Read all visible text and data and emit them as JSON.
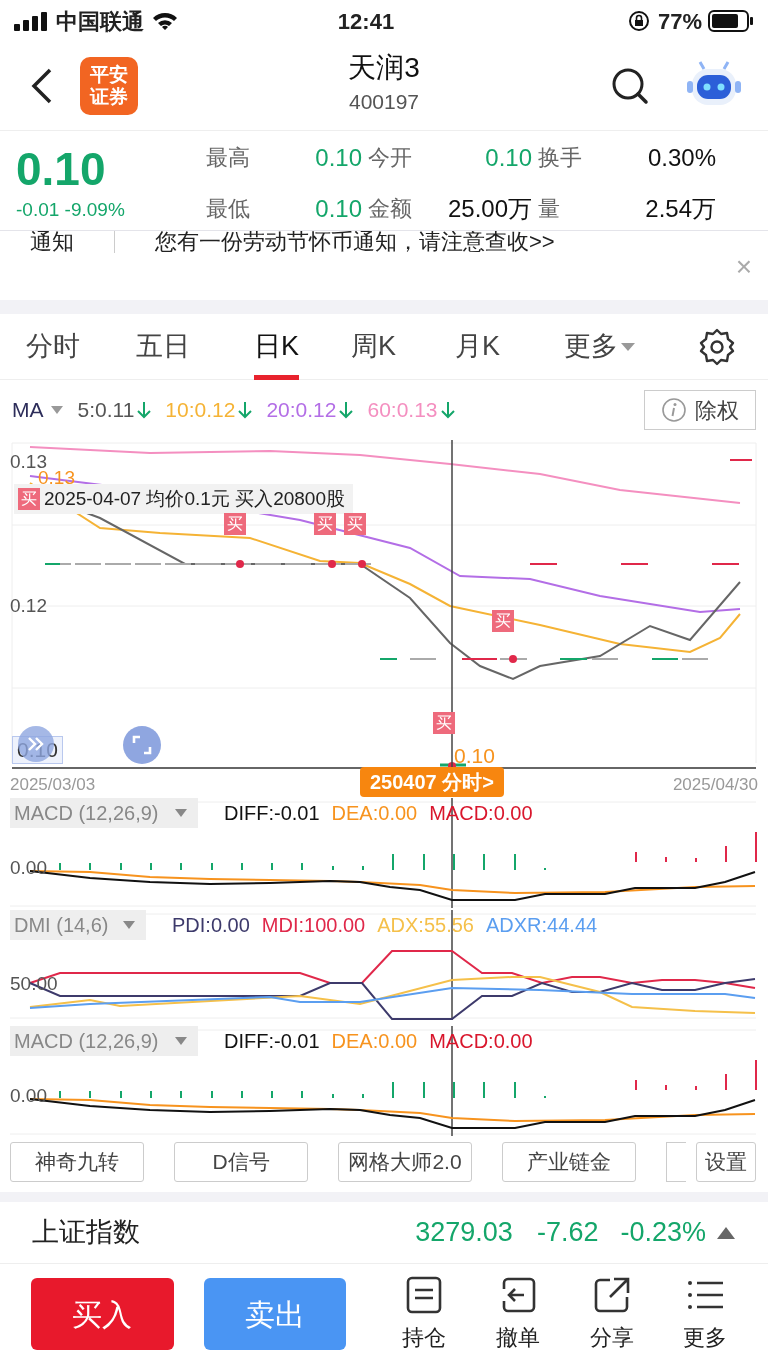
{
  "status_bar": {
    "carrier": "中国联通",
    "time": "12:41",
    "battery": "77%"
  },
  "header": {
    "title": "天润3",
    "code": "400197",
    "logo": [
      "平安",
      "证券"
    ]
  },
  "quote": {
    "price": "0.10",
    "change": "-0.01 -9.09%",
    "stats": [
      {
        "label": "最高",
        "value": "0.10",
        "kind": "down"
      },
      {
        "label": "今开",
        "value": "0.10",
        "kind": "down"
      },
      {
        "label": "换手",
        "value": "0.30%",
        "kind": "plain"
      },
      {
        "label": "最低",
        "value": "0.10",
        "kind": "down"
      },
      {
        "label": "金额",
        "value": "25.00万",
        "kind": "plain"
      },
      {
        "label": "量",
        "value": "2.54万",
        "kind": "plain"
      }
    ]
  },
  "notice": {
    "tag": "通知",
    "text": "您有一份劳动节怀币通知，请注意查收>>",
    "close": "×"
  },
  "tabs": [
    {
      "label": "分时",
      "selected": false,
      "kind": "tab"
    },
    {
      "label": "五日",
      "selected": false,
      "kind": "tab"
    },
    {
      "label": "日K",
      "selected": true,
      "kind": "tab"
    },
    {
      "label": "周K",
      "selected": false,
      "kind": "tab"
    },
    {
      "label": "月K",
      "selected": false,
      "kind": "tab"
    },
    {
      "label": "更多",
      "selected": false,
      "kind": "menu"
    }
  ],
  "ma": {
    "label": "MA",
    "items": [
      {
        "text": "5:0.11",
        "color": "#555555"
      },
      {
        "text": "10:0.12",
        "color": "#f5b335"
      },
      {
        "text": "20:0.12",
        "color": "#b36ee6"
      },
      {
        "text": "60:0.13",
        "color": "#f48fc0"
      }
    ],
    "button": "除权"
  },
  "main_chart": {
    "y_labels": [
      "0.13",
      "0.12",
      "0.10"
    ],
    "max_label": "0.13",
    "min_label": "0.10",
    "tooltip": {
      "tag": "买",
      "text": "2025-04-07 均价0.1元 买入20800股"
    },
    "markers": [
      "买",
      "买",
      "买",
      "买",
      "买"
    ],
    "start_date": "2025/03/03",
    "end_date": "2025/04/30",
    "badge": "250407 分时>"
  },
  "indicators": [
    {
      "kind": "macd",
      "name": "MACD (12,26,9)",
      "axis": "0.00",
      "values": [
        {
          "text": "DIFF:-0.01",
          "color": "#111111"
        },
        {
          "text": "DEA:0.00",
          "color": "#f7931e"
        },
        {
          "text": "MACD:0.00",
          "color": "#d9162c"
        }
      ]
    },
    {
      "kind": "dmi",
      "name": "DMI (14,6)",
      "axis": "50.00",
      "values": [
        {
          "text": "PDI:0.00",
          "color": "#3d3a6b"
        },
        {
          "text": "MDI:100.00",
          "color": "#e0284a"
        },
        {
          "text": "ADX:55.56",
          "color": "#f5c04a"
        },
        {
          "text": "ADXR:44.44",
          "color": "#5b9ef0"
        }
      ]
    },
    {
      "kind": "macd",
      "name": "MACD (12,26,9)",
      "axis": "0.00",
      "values": [
        {
          "text": "DIFF:-0.01",
          "color": "#111111"
        },
        {
          "text": "DEA:0.00",
          "color": "#f7931e"
        },
        {
          "text": "MACD:0.00",
          "color": "#d9162c"
        }
      ]
    }
  ],
  "tools": [
    "神奇九转",
    "D信号",
    "网格大师2.0",
    "产业链金"
  ],
  "settings": "设置",
  "index": {
    "name": "上证指数",
    "value": "3279.03",
    "change": "-7.62",
    "percent": "-0.23%"
  },
  "actions": {
    "buy": "买入",
    "sell": "卖出",
    "items": [
      {
        "label": "持仓",
        "kind": "hold"
      },
      {
        "label": "撤单",
        "kind": "cancel"
      },
      {
        "label": "分享",
        "kind": "share"
      },
      {
        "label": "更多",
        "kind": "more"
      }
    ]
  }
}
